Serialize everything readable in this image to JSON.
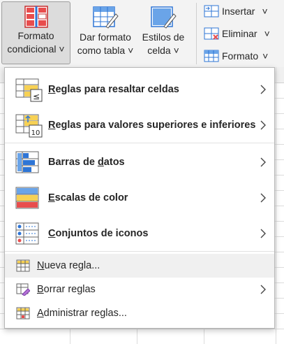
{
  "ribbon": {
    "conditional_format": {
      "line1": "Formato",
      "line2": "condicional",
      "arrow": "˅"
    },
    "format_table": {
      "line1": "Dar formato",
      "line2": "como tabla",
      "arrow": "˅"
    },
    "cell_styles": {
      "line1": "Estilos de",
      "line2": "celda",
      "arrow": "˅"
    },
    "insert": {
      "label": "Insertar",
      "arrow": "˅"
    },
    "delete": {
      "label": "Eliminar",
      "arrow": "˅"
    },
    "format": {
      "label": "Formato",
      "arrow": "˅"
    }
  },
  "menu": {
    "items": [
      {
        "key": "R",
        "rest": "eglas para resaltar celdas",
        "icon": "highlight-rules-icon"
      },
      {
        "key": "R",
        "rest": "eglas para valores superiores e inferiores",
        "icon": "top-bottom-rules-icon"
      },
      {
        "pre": "Barras de ",
        "key": "d",
        "rest": "atos",
        "icon": "data-bars-icon"
      },
      {
        "key": "E",
        "rest": "scalas de color",
        "icon": "color-scales-icon"
      },
      {
        "key": "C",
        "rest": "onjuntos de iconos",
        "icon": "icon-sets-icon"
      },
      {
        "key": "N",
        "rest": "ueva regla...",
        "icon": "new-rule-icon"
      },
      {
        "key": "B",
        "rest": "orrar reglas",
        "icon": "clear-rules-icon"
      },
      {
        "key": "A",
        "rest": "dministrar reglas...",
        "icon": "manage-rules-icon"
      }
    ]
  },
  "colors": {
    "accent": "#2e75d6",
    "red": "#e84d4d",
    "yellow": "#f7d154",
    "ribbon_bg": "#f3f3f3"
  }
}
